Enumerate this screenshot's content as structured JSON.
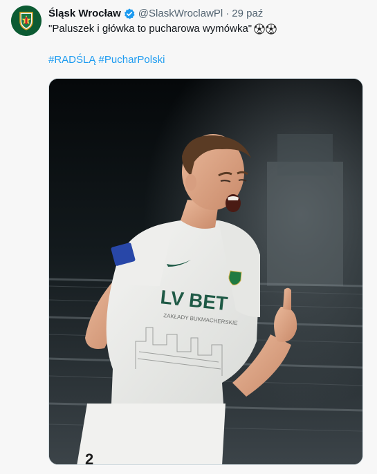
{
  "author": {
    "display_name": "Śląsk Wrocław",
    "handle": "@SlaskWroclawPl",
    "separator": "·",
    "time": "29 paź",
    "verified_icon": "verified-badge-icon",
    "avatar_icon": "club-crest-icon"
  },
  "tweet": {
    "text": "\"Paluszek i główka to pucharowa wymówka\"",
    "emoji": [
      "soccer-ball-icon",
      "soccer-ball-icon"
    ],
    "hashtags": [
      "#RADŚLĄ",
      "#PucharPolski"
    ]
  },
  "media": {
    "type": "photo",
    "shirt_sponsor": "LV BET",
    "shirt_sponsor_sub": "ZAKŁADY BUKMACHERSKIE"
  },
  "colors": {
    "link": "#1d9bf0",
    "secondary_text": "#536471",
    "primary_text": "#0f1419",
    "background": "#f7f7f7",
    "club_green": "#0c5b33"
  }
}
